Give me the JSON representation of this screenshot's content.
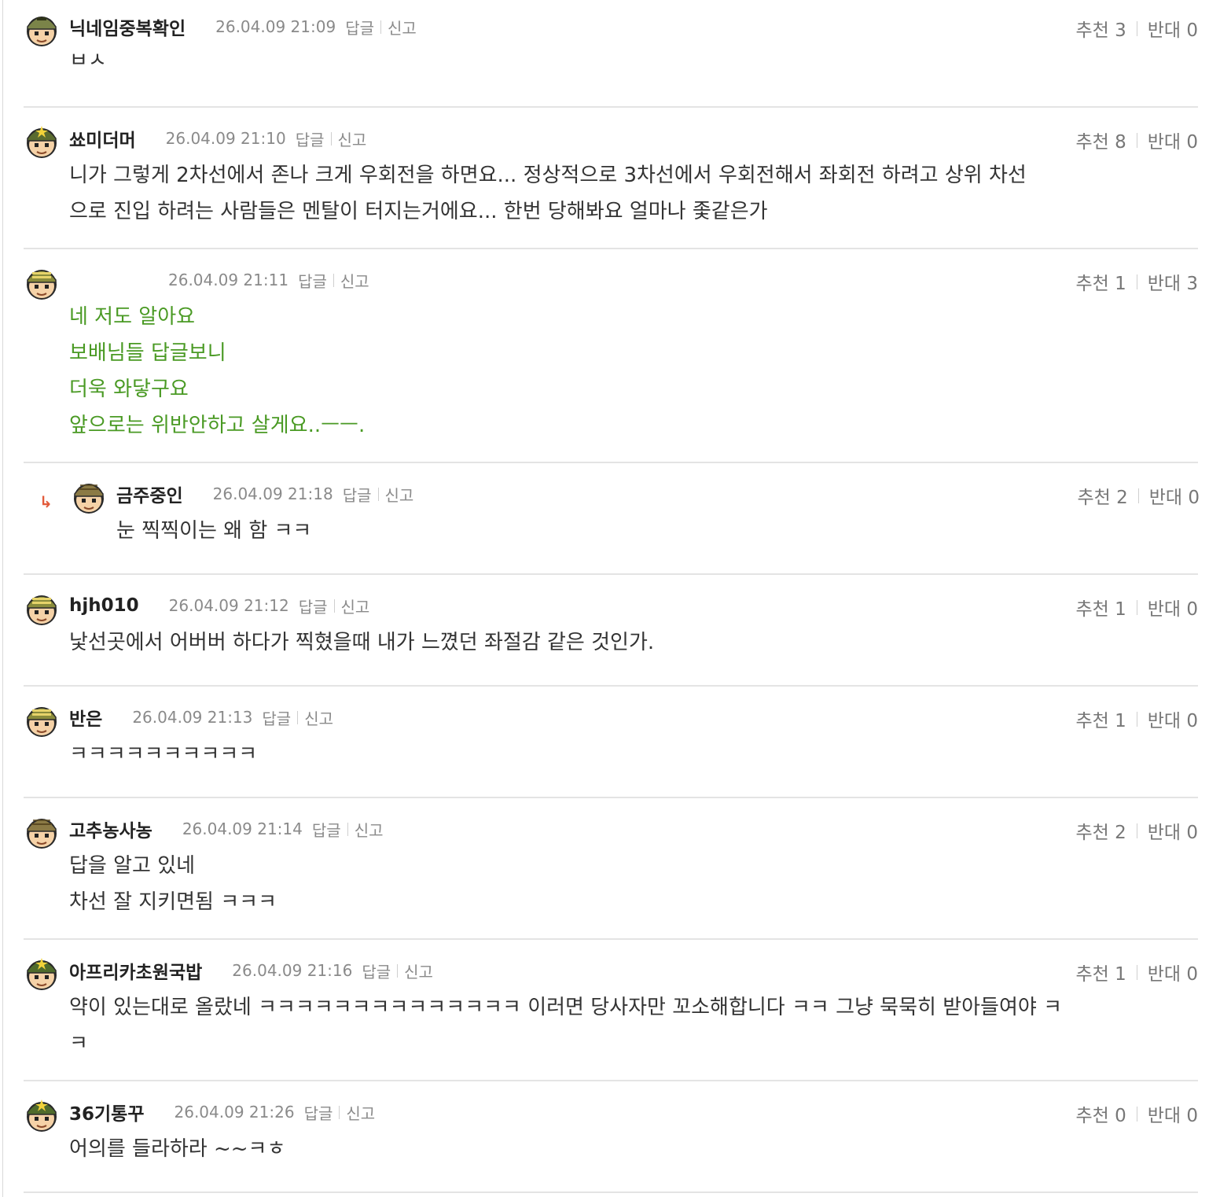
{
  "comments": [
    {
      "nick": "닉네임중복확인",
      "time": "26.04.09 21:09",
      "reply_label": "답글",
      "report_label": "신고",
      "recommend_label": "추천",
      "recommend": "3",
      "oppose_label": "반대",
      "oppose": "0",
      "lines": [
        "ㅂㅅ"
      ]
    },
    {
      "nick": "쑈미더머",
      "time": "26.04.09 21:10",
      "reply_label": "답글",
      "report_label": "신고",
      "recommend_label": "추천",
      "recommend": "8",
      "oppose_label": "반대",
      "oppose": "0",
      "lines": [
        "니가 그렇게 2차선에서 존나 크게 우회전을 하면요... 정상적으로 3차선에서 우회전해서 좌회전 하려고 상위 차선",
        "으로 진입 하려는 사람들은 멘탈이 터지는거에요... 한번 당해봐요 얼마나 좇같은가"
      ]
    },
    {
      "nick": "",
      "time": "26.04.09 21:11",
      "reply_label": "답글",
      "report_label": "신고",
      "recommend_label": "추천",
      "recommend": "1",
      "oppose_label": "반대",
      "oppose": "3",
      "lines": [
        "네 저도 알아요",
        "보배님들 답글보니",
        "더욱 와닿구요",
        "앞으로는 위반안하고 살게요..ㅡㅡ."
      ],
      "text_color": "#4a9a24"
    },
    {
      "nick": "금주중인",
      "time": "26.04.09 21:18",
      "reply_label": "답글",
      "report_label": "신고",
      "recommend_label": "추천",
      "recommend": "2",
      "oppose_label": "반대",
      "oppose": "0",
      "lines": [
        "눈 찍찍이는 왜 함 ㅋㅋ"
      ],
      "reply_marker": "↳"
    },
    {
      "nick": "hjh010",
      "time": "26.04.09 21:12",
      "reply_label": "답글",
      "report_label": "신고",
      "recommend_label": "추천",
      "recommend": "1",
      "oppose_label": "반대",
      "oppose": "0",
      "lines": [
        "낯선곳에서 어버버 하다가 찍혔을때 내가 느꼈던 좌절감 같은 것인가."
      ]
    },
    {
      "nick": "반은",
      "time": "26.04.09 21:13",
      "reply_label": "답글",
      "report_label": "신고",
      "recommend_label": "추천",
      "recommend": "1",
      "oppose_label": "반대",
      "oppose": "0",
      "lines": [
        "ㅋㅋㅋㅋㅋㅋㅋㅋㅋㅋ"
      ]
    },
    {
      "nick": "고추농사농",
      "time": "26.04.09 21:14",
      "reply_label": "답글",
      "report_label": "신고",
      "recommend_label": "추천",
      "recommend": "2",
      "oppose_label": "반대",
      "oppose": "0",
      "lines": [
        "답을 알고 있네",
        "차선 잘 지키면됨 ㅋㅋㅋ"
      ]
    },
    {
      "nick": "아프리카초원국밥",
      "time": "26.04.09 21:16",
      "reply_label": "답글",
      "report_label": "신고",
      "recommend_label": "추천",
      "recommend": "1",
      "oppose_label": "반대",
      "oppose": "0",
      "lines": [
        "약이 있는대로 올랐네 ㅋㅋㅋㅋㅋㅋㅋㅋㅋㅋㅋㅋㅋㅋ 이러면 당사자만 꼬소해합니다 ㅋㅋ 그냥 묵묵히 받아들여야 ㅋ",
        "ㅋ"
      ]
    },
    {
      "nick": "36기통꾸",
      "time": "26.04.09 21:26",
      "reply_label": "답글",
      "report_label": "신고",
      "recommend_label": "추천",
      "recommend": "0",
      "oppose_label": "반대",
      "oppose": "0",
      "lines": [
        "어의를 들라하라 ~~ㅋㅎ"
      ]
    }
  ],
  "colors": {
    "green_text": "#4a9a24",
    "reply_arrow": "#e25a3a",
    "separator": "#e4e4e4"
  },
  "icons": {
    "avatar": "soldier-avatar-icon",
    "reply_marker": "reply-arrow-icon"
  }
}
